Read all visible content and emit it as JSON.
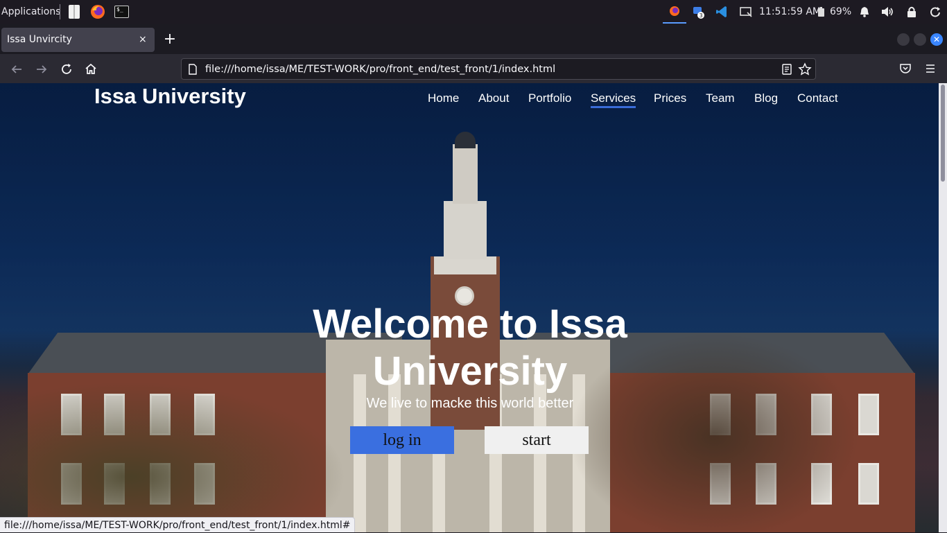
{
  "panel": {
    "applications_label": "Applications",
    "clock": "11:51:59 AM",
    "battery": "69%",
    "chat_badge": "3"
  },
  "browser": {
    "tab_title": "Issa Unvircity",
    "tab_close": "×",
    "new_tab": "+",
    "url": "file:///home/issa/ME/TEST-WORK/pro/front_end/test_front/1/index.html",
    "status_url": "file:///home/issa/ME/TEST-WORK/pro/front_end/test_front/1/index.html#",
    "close_glyph": "✕"
  },
  "site": {
    "logo": "Issa University",
    "nav": [
      {
        "label": "Home"
      },
      {
        "label": "About"
      },
      {
        "label": "Portfolio"
      },
      {
        "label": "Services"
      },
      {
        "label": "Prices"
      },
      {
        "label": "Team"
      },
      {
        "label": "Blog"
      },
      {
        "label": "Contact"
      }
    ],
    "active_nav": "Services",
    "hero": {
      "title": "Welcome to Issa University",
      "subtitle": "We live to macke this world better",
      "login_label": "log in",
      "start_label": "start"
    }
  },
  "colors": {
    "accent": "#3a6fe0",
    "browser_chrome": "#2b2a33",
    "panel": "#1d1a22"
  }
}
